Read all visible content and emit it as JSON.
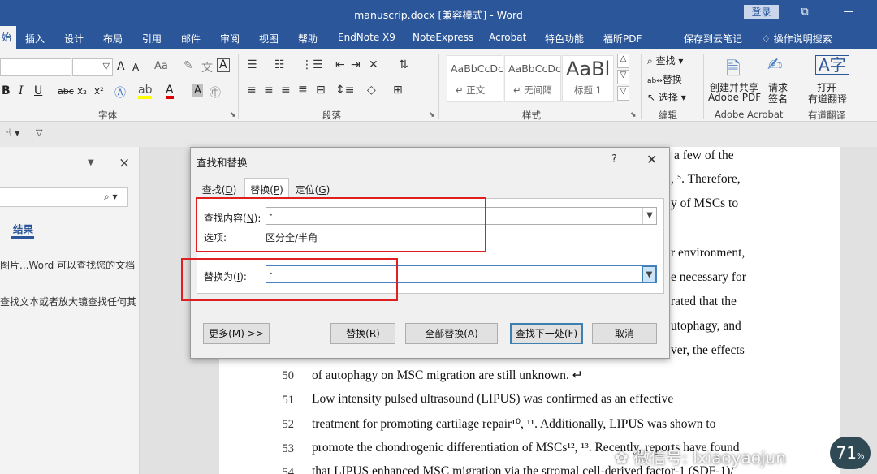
{
  "window": {
    "title": "manuscrip.docx [兼容模式] - Word",
    "login_label": "登录",
    "restore_glyph": "⧉",
    "minimize_glyph": "—"
  },
  "menu_tabs": [
    {
      "label": "始",
      "active": true
    },
    {
      "label": "插入"
    },
    {
      "label": "设计"
    },
    {
      "label": "布局"
    },
    {
      "label": "引用"
    },
    {
      "label": "邮件"
    },
    {
      "label": "审阅"
    },
    {
      "label": "视图"
    },
    {
      "label": "帮助"
    },
    {
      "label": "EndNote X9"
    },
    {
      "label": "NoteExpress"
    },
    {
      "label": "Acrobat"
    },
    {
      "label": "特色功能"
    },
    {
      "label": "福昕PDF"
    },
    {
      "label": "保存到云笔记"
    },
    {
      "label": "操作说明搜索"
    }
  ],
  "ribbon": {
    "groups": {
      "font": "字体",
      "paragraph": "段落",
      "styles": "样式",
      "editing": "编辑",
      "adobe": "Adobe Acrobat",
      "youdao": "有道翻译"
    },
    "font_buttons": {
      "grow": "A",
      "shrink": "A",
      "case": "Aa",
      "bold": "B",
      "italic": "I",
      "underline": "U",
      "strike": "abc",
      "subscript": "x₂",
      "superscript": "x²",
      "phonetic": "文",
      "char_border": "A",
      "char_shade": "A"
    },
    "styles": [
      {
        "sample": "AaBbCcDc",
        "name": "↵ 正文"
      },
      {
        "sample": "AaBbCcDc",
        "name": "↵ 无间隔"
      },
      {
        "sample": "AaBl",
        "name": "标题 1"
      }
    ],
    "editing": {
      "find": "查找",
      "replace": "替换",
      "select": "选择"
    },
    "adobe": {
      "create_line1": "创建并共享",
      "create_line2": "Adobe PDF",
      "sign_line1": "请求",
      "sign_line2": "签名"
    },
    "youdao": {
      "open_line1": "打开",
      "open_line2": "有道翻译"
    }
  },
  "navpane": {
    "close_glyph": "×",
    "results_tab": "结果",
    "hint1": "图片...Word 可以查找您的文档",
    "hint2": "查找文本或者放大镜查找任何其"
  },
  "dialog": {
    "title": "查找和替换",
    "help": "?",
    "close": "✕",
    "tabs": [
      {
        "label": "查找(",
        "key": "D",
        "end": ")"
      },
      {
        "label": "替换(",
        "key": "P",
        "end": ")",
        "active": true
      },
      {
        "label": "定位(",
        "key": "G",
        "end": ")"
      }
    ],
    "find_label": "查找内容(",
    "find_key": "N",
    "find_label_end": "):",
    "find_value": "·",
    "options_label": "选项:",
    "options_value": "区分全/半角",
    "replace_label": "替换为(",
    "replace_key": "I",
    "replace_label_end": "):",
    "replace_value": "·",
    "buttons": {
      "more": "更多(M) >>",
      "replace": "替换(R)",
      "replace_all": "全部替换(A)",
      "find_next": "查找下一处(F)",
      "cancel": "取消"
    }
  },
  "document": {
    "right_fragments": [
      "a few of the",
      ", ⁵. Therefore,",
      "y of MSCs to",
      "r environment,",
      "e necessary for",
      "rated that the",
      "utophagy, and",
      "ver, the effects"
    ],
    "lines": [
      {
        "num": "50",
        "text": "of autophagy on MSC migration are still unknown. ↵"
      },
      {
        "num": "51",
        "text": "     Low intensity pulsed ultrasound (LIPUS) was confirmed as an effective"
      },
      {
        "num": "52",
        "text": "treatment for promoting cartilage repair¹⁰, ¹¹. Additionally, LIPUS was shown to"
      },
      {
        "num": "53",
        "text": "promote the chondrogenic differentiation of MSCs¹², ¹³. Recently, reports have found"
      },
      {
        "num": "54",
        "text": "that LIPUS enhanced MSC migration via the stromal cell-derived factor-1 (SDF-1)/"
      }
    ]
  },
  "overlay": {
    "watermark": "微信号: lxiaoyaojun",
    "zoom": "71"
  },
  "colors": {
    "word_blue": "#2b579a",
    "highlight_red": "#e02020"
  }
}
